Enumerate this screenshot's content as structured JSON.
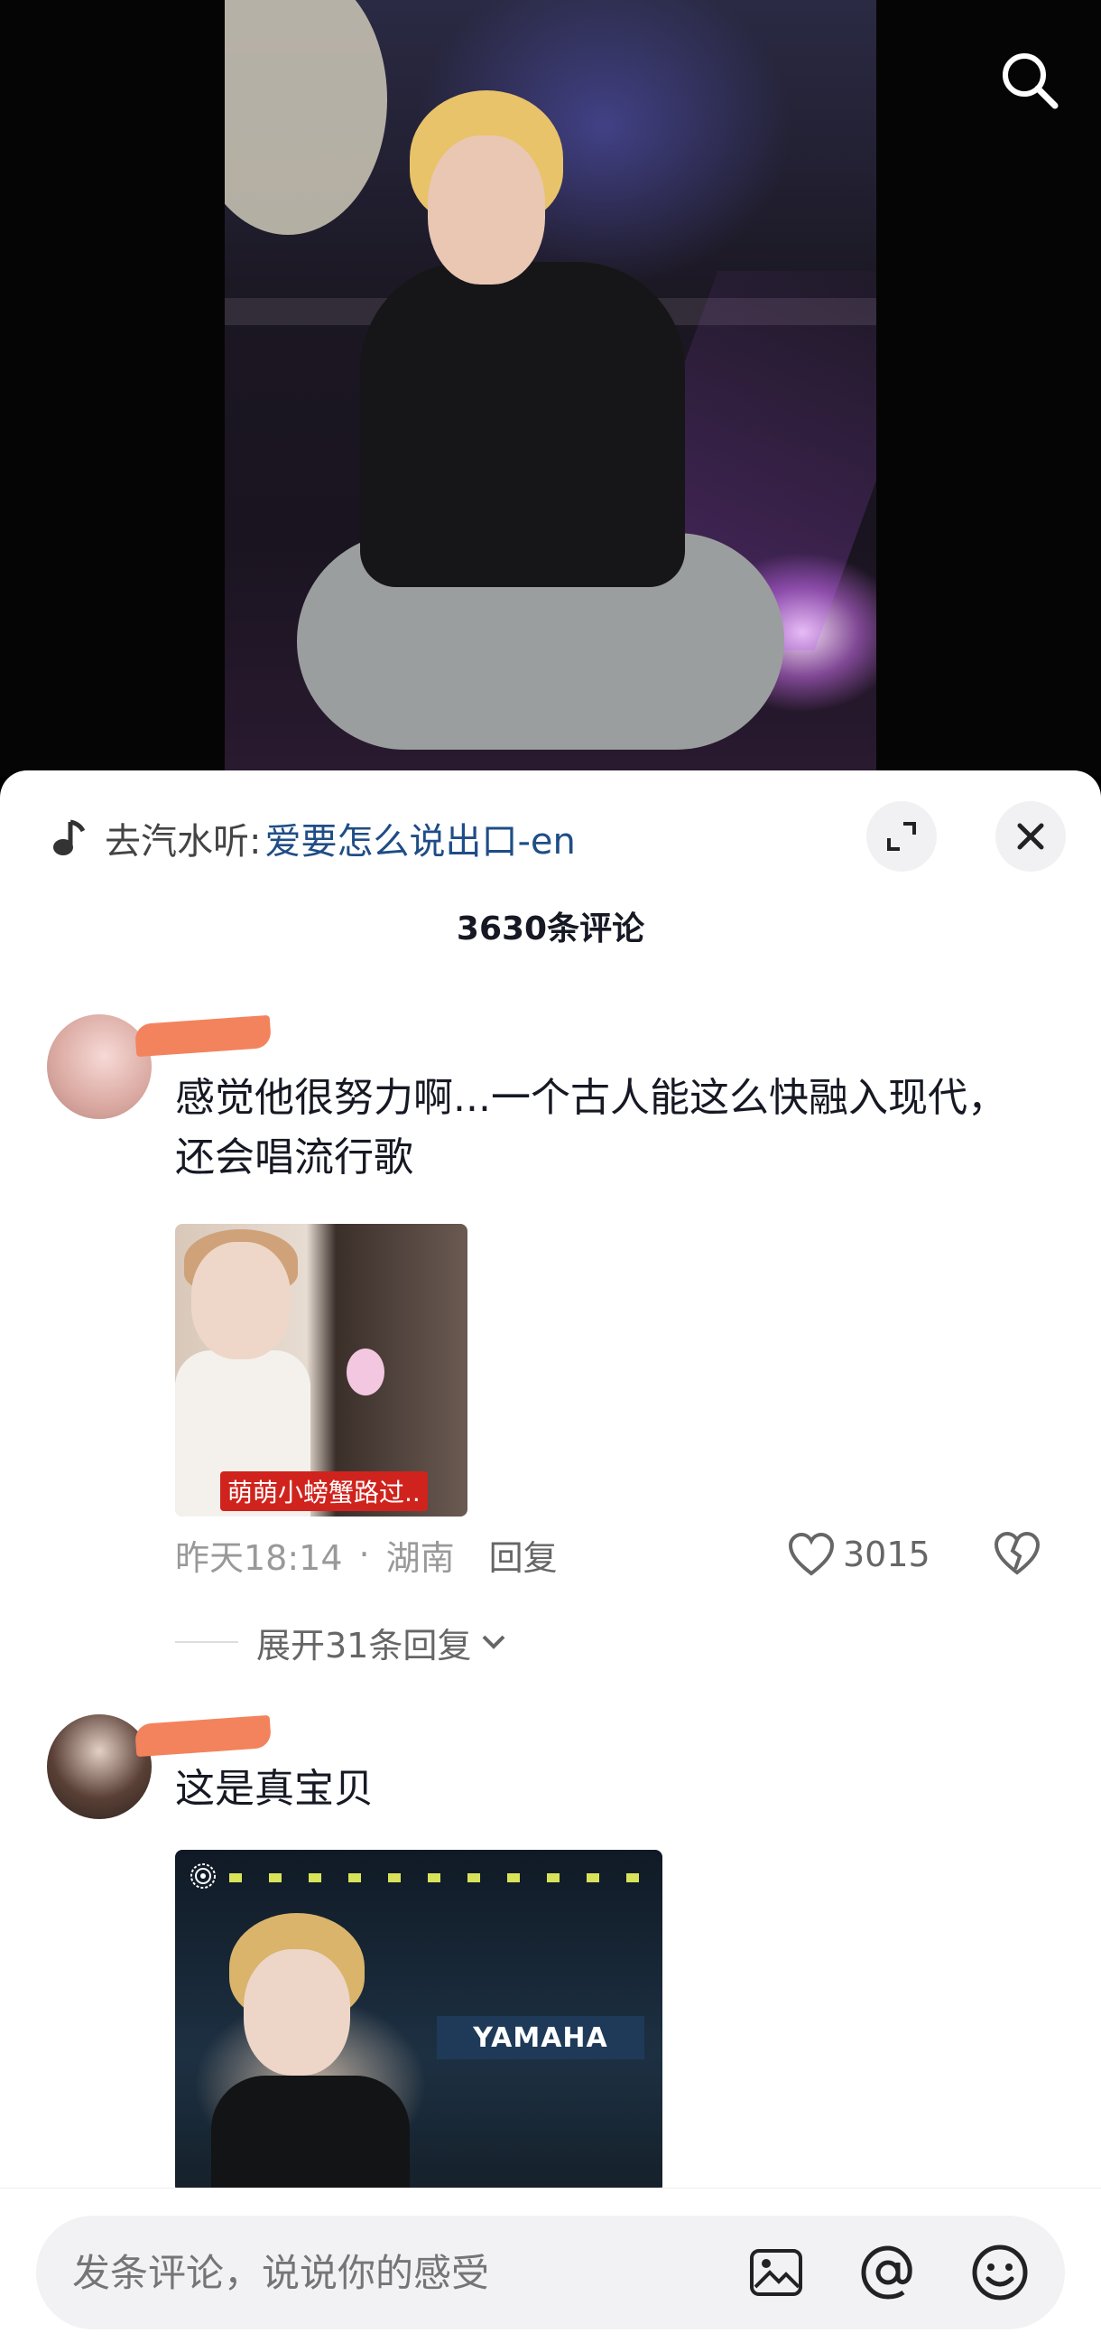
{
  "header": {
    "search_icon": "search-icon"
  },
  "music": {
    "prefix": "去汽水听:",
    "song": "爱要怎么说出口-en",
    "icon": "music-note-icon"
  },
  "sheet": {
    "comment_count": "3630条评论"
  },
  "comments": [
    {
      "text": "感觉他很努力啊...一个古人能这么快融入现代，还会唱流行歌",
      "image_caption": "萌萌小螃蟹路过..",
      "time": "昨天18:14",
      "location": "湖南",
      "reply_label": "回复",
      "likes": "3015",
      "expand_replies": "展开31条回复"
    },
    {
      "text": "这是真宝贝",
      "image_brand": "YAMAHA"
    }
  ],
  "bottom_bar": {
    "placeholder": "发条评论，说说你的感受",
    "icons": [
      "image-icon",
      "at-icon",
      "emoji-icon"
    ]
  },
  "colors": {
    "link": "#1f4d86",
    "muted": "#999999",
    "caption_red": "#d0231d",
    "scribble": "#f3835d"
  }
}
